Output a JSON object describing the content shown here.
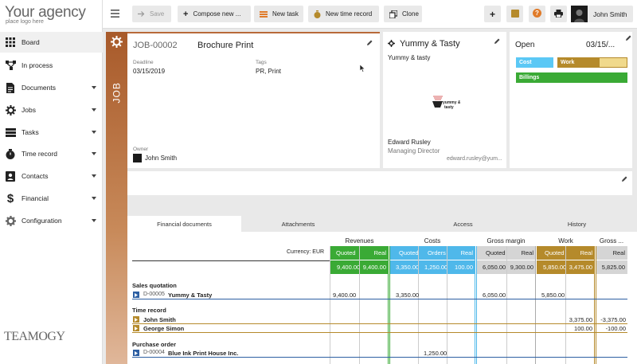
{
  "brand": {
    "logo": "Your agency",
    "logo_sub": "place logo here",
    "footer_logo": "TEAMOGY"
  },
  "nav": [
    {
      "label": "Board",
      "icon": "grid-icon",
      "caret": false
    },
    {
      "label": "In process",
      "icon": "workflow-icon",
      "caret": false
    },
    {
      "label": "Documents",
      "icon": "document-icon",
      "caret": true
    },
    {
      "label": "Jobs",
      "icon": "jobs-gear-icon",
      "caret": true
    },
    {
      "label": "Tasks",
      "icon": "tasks-icon",
      "caret": true
    },
    {
      "label": "Time record",
      "icon": "stopwatch-icon",
      "caret": true
    },
    {
      "label": "Contacts",
      "icon": "contacts-icon",
      "caret": true
    },
    {
      "label": "Financial",
      "icon": "dollar-icon",
      "caret": true
    },
    {
      "label": "Configuration",
      "icon": "settings-gear-icon",
      "caret": true
    }
  ],
  "toolbar": {
    "save": "Save",
    "compose": "Compose new ...",
    "new_task": "New task",
    "new_time_record": "New time record",
    "clone": "Clone",
    "user": "John Smith"
  },
  "job": {
    "side_label": "JOB",
    "number": "JOB-00002",
    "name": "Brochure Print",
    "deadline_label": "Deadline",
    "deadline": "03/15/2019",
    "tags_label": "Tags",
    "tags": "PR, Print",
    "owner_label": "Owner",
    "owner": "John Smith"
  },
  "client": {
    "name": "Yummy & Tasty",
    "subtitle": "Yummy & tasty",
    "logo_text": "yummy & tasty",
    "contact_name": "Edward Rusley",
    "contact_role": "Managing Director",
    "contact_email": "edward.rusley@yum..."
  },
  "status": {
    "state": "Open",
    "date": "03/15/...",
    "bars": [
      {
        "label": "Cost",
        "color": "#5bc8f5",
        "fill": 1.0
      },
      {
        "label": "Work",
        "color": "#b58a2b",
        "fill": 0.6
      },
      {
        "label": "Billings",
        "color": "#3aaa35",
        "fill": 1.0
      }
    ]
  },
  "tabs": [
    "Financial documents",
    "Attachments",
    "Access",
    "History"
  ],
  "financial": {
    "currency": "Currency: EUR",
    "groups": [
      {
        "name": "Revenues",
        "color": "#3aaa35",
        "cols": [
          "Quoted",
          "Real"
        ],
        "totals": [
          "9,400.00",
          "9,400.00"
        ]
      },
      {
        "name": "Costs",
        "color": "#4fb8ea",
        "cols": [
          "Quoted",
          "Orders",
          "Real"
        ],
        "totals": [
          "3,350.00",
          "1,250.00",
          "100.00"
        ]
      },
      {
        "name": "Gross margin",
        "color": "#cfcfcf",
        "cols": [
          "Quoted",
          "Real"
        ],
        "totals": [
          "6,050.00",
          "9,300.00"
        ]
      },
      {
        "name": "Work",
        "color": "#b58a2b",
        "cols": [
          "Quoted",
          "Real"
        ],
        "totals": [
          "5,850.00",
          "3,475.00"
        ]
      },
      {
        "name": "Gross ...",
        "color": "#cfcfcf",
        "cols": [
          "Real"
        ],
        "totals": [
          "5,825.00"
        ]
      }
    ],
    "sections": [
      {
        "title": "Sales quotation",
        "rows": [
          {
            "code": "D-00005",
            "name": "Yummy & Tasty",
            "tag_color": "#2d5fa3",
            "values": {
              "rev_q": "9,400.00",
              "cost_q": "3,350.00",
              "gm_q": "6,050.00",
              "work_q": "5,850.00"
            }
          }
        ]
      },
      {
        "title": "Time record",
        "rows": [
          {
            "code": "",
            "name": "John Smith",
            "tag_color": "#b58a2b",
            "values": {
              "work_r": "3,375.00",
              "gross_r": "-3,375.00"
            }
          },
          {
            "code": "",
            "name": "George Simon",
            "tag_color": "#b58a2b",
            "values": {
              "work_r": "100.00",
              "gross_r": "-100.00"
            }
          }
        ]
      },
      {
        "title": "Purchase order",
        "rows": [
          {
            "code": "D-00004",
            "name": "Blue Ink Print House Inc.",
            "tag_color": "#2d5fa3",
            "values": {
              "cost_o": "1,250.00"
            }
          }
        ]
      }
    ]
  }
}
